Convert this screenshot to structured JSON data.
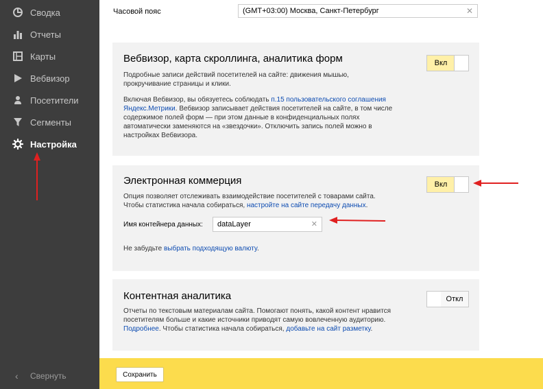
{
  "sidebar": {
    "items": [
      {
        "label": "Сводка",
        "icon": "pie-chart-icon"
      },
      {
        "label": "Отчеты",
        "icon": "bar-chart-icon"
      },
      {
        "label": "Карты",
        "icon": "map-icon"
      },
      {
        "label": "Вебвизор",
        "icon": "play-icon"
      },
      {
        "label": "Посетители",
        "icon": "person-icon"
      },
      {
        "label": "Сегменты",
        "icon": "filter-icon"
      },
      {
        "label": "Настройка",
        "icon": "gear-icon",
        "active": true
      }
    ],
    "collapse_label": "Свернуть"
  },
  "timezone": {
    "label": "Часовой пояс",
    "value": "(GMT+03:00) Москва, Санкт-Петербург"
  },
  "webvisor": {
    "title": "Вебвизор, карта скроллинга, аналитика форм",
    "desc": "Подробные записи действий посетителей на сайте: движения мышью, прокручивание страницы и клики.",
    "note_pre": "Включая Вебвизор, вы обязуетесь соблюдать ",
    "note_link": "п.15 пользовательского соглашения Яндекс.Метрики",
    "note_post": ". Вебвизор записывает действия посетителей на сайте, в том числе содержимое полей форм — при этом данные в конфиденциальных полях автоматически заменяются на «звездочки». Отключить запись полей можно в настройках Вебвизора.",
    "toggle_label": "Вкл"
  },
  "ecommerce": {
    "title": "Электронная коммерция",
    "desc_pre": "Опция позволяет отслеживать взаимодействие посетителей с товарами сайта. Чтобы статистика начала собираться, ",
    "desc_link": "настройте на сайте передачу данных",
    "desc_post": ".",
    "container_label": "Имя контейнера данных:",
    "container_value": "dataLayer",
    "currency_pre": "Не забудьте ",
    "currency_link": "выбрать подходящую валюту",
    "currency_post": ".",
    "toggle_label": "Вкл"
  },
  "content": {
    "title": "Контентная аналитика",
    "desc": "Отчеты по текстовым материалам сайта. Помогают понять, какой контент нравится посетителям больше и какие источники приводят самую вовлеченную аудиторию.",
    "link1": "Подробнее",
    "mid": ". Чтобы статистика начала собираться, ",
    "link2": "добавьте на сайт разметку",
    "end": ".",
    "toggle_label": "Откл"
  },
  "footer": {
    "save_label": "Сохранить"
  },
  "colors": {
    "sidebar_bg": "#3d3d3d",
    "footer_bg": "#fcdc4d",
    "toggle_on": "#fff0a8",
    "link": "#0c4bb1",
    "arrow": "#e02020"
  }
}
